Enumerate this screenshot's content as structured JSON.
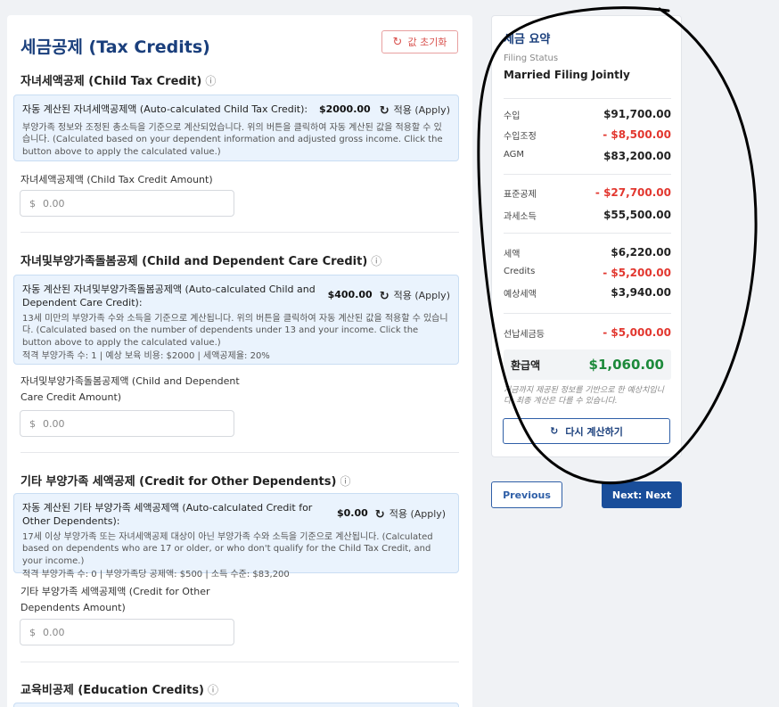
{
  "header": {
    "title": "세금공제 (Tax Credits)",
    "reset_label": "값 초기화"
  },
  "child_tax": {
    "title": "자녀세액공제 (Child Tax Credit)",
    "auto_label": "자동 계산된 자녀세액공제액 (Auto-calculated Child Tax Credit):",
    "auto_amount": "$2000.00",
    "apply_label": "적용 (Apply)",
    "desc": "부양가족 정보와 조정된 총소득을 기준으로 계산되었습니다. 위의 버튼을 클릭하여 자동 계산된 값을 적용할 수 있습니다. (Calculated based on your dependent information and adjusted gross income. Click the button above to apply the calculated value.)",
    "field_label": "자녀세액공제액 (Child Tax Credit Amount)",
    "field_placeholder": "0.00",
    "currency": "$"
  },
  "dependent_care": {
    "title": "자녀및부양가족돌봄공제 (Child and Dependent Care Credit)",
    "auto_label": "자동 계산된 자녀및부양가족돌봄공제액 (Auto-calculated Child and Dependent Care Credit):",
    "auto_amount": "$400.00",
    "apply_label": "적용 (Apply)",
    "desc": "13세 미만의 부양가족 수와 소득을 기준으로 계산됩니다. 위의 버튼을 클릭하여 자동 계산된 값을 적용할 수 있습니다. (Calculated based on the number of dependents under 13 and your income. Click the button above to apply the calculated value.)",
    "meta": "적격 부양가족 수: 1 | 예상 보육 비용: $2000 | 세액공제율: 20%",
    "field_label_1": "자녀및부양가족돌봄공제액 (Child and Dependent",
    "field_label_2": "Care Credit Amount)",
    "field_placeholder": "0.00",
    "currency": "$"
  },
  "other_dependents": {
    "title": "기타 부양가족 세액공제 (Credit for Other Dependents)",
    "auto_label": "자동 계산된 기타 부양가족 세액공제액 (Auto-calculated Credit for Other Dependents):",
    "auto_amount": "$0.00",
    "apply_label": "적용 (Apply)",
    "desc": "17세 이상 부양가족 또는 자녀세액공제 대상이 아닌 부양가족 수와 소득을 기준으로 계산됩니다. (Calculated based on dependents who are 17 or older, or who don't qualify for the Child Tax Credit, and your income.)",
    "meta": "적격 부양가족 수: 0 | 부양가족당 공제액: $500 | 소득 수준: $83,200",
    "field_label_1": "기타 부양가족 세액공제액 (Credit for Other",
    "field_label_2": "Dependents Amount)",
    "field_placeholder": "0.00",
    "currency": "$"
  },
  "education": {
    "title": "교육비공제 (Education Credits)"
  },
  "summary": {
    "title": "세금 요약",
    "filing_status_label": "Filing Status",
    "filing_status_value": "Married Filing Jointly",
    "rows": [
      {
        "label": "수입",
        "value": "$91,700.00"
      },
      {
        "label": "수입조정",
        "value": "- $8,500.00"
      },
      {
        "label": "AGM",
        "value": "$83,200.00"
      },
      {
        "label": "표준공제",
        "value": "- $27,700.00"
      },
      {
        "label": "과세소득",
        "value": "$55,500.00"
      },
      {
        "label": "세액",
        "value": "$6,220.00"
      },
      {
        "label": "Credits",
        "value": "- $5,200.00"
      },
      {
        "label": "예상세액",
        "value": "$3,940.00"
      },
      {
        "label": "선납세금등",
        "value": "- $5,000.00"
      }
    ],
    "refund_label": "환급액",
    "refund_value": "$1,060.00",
    "note": "지금까지 제공된 정보를 기반으로 한 예상치입니다. 최종 계산은 다를 수 있습니다.",
    "recalc_label": "다시 계산하기"
  },
  "nav": {
    "previous_label": "Previous",
    "next_label": "Next: Next"
  },
  "colors": {
    "accent": "#1a4e9a",
    "negative": "#e2372f",
    "refund": "#1d8a3b"
  }
}
